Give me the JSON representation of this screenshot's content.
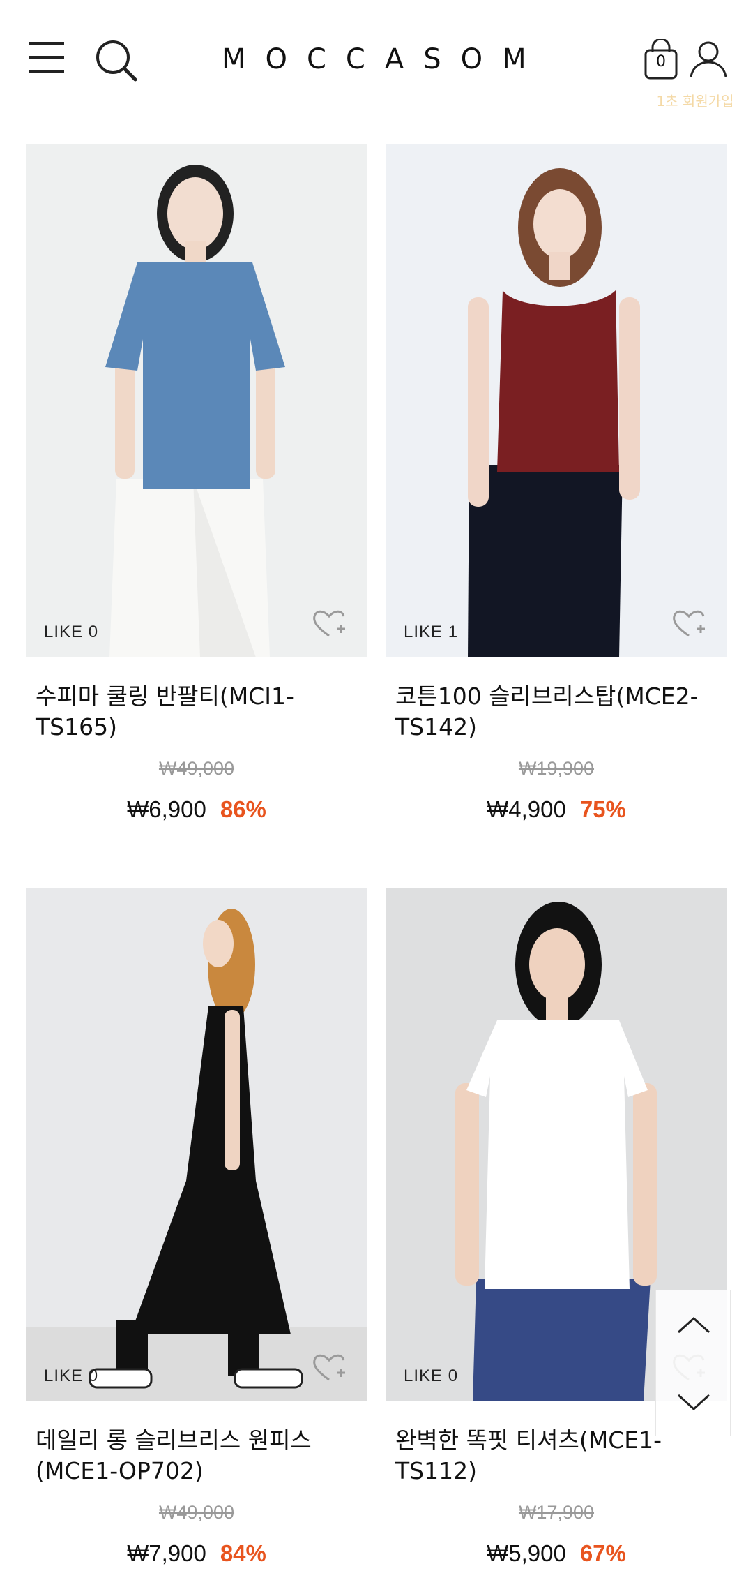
{
  "header": {
    "logo": "MOCCASOM",
    "cart_count": "0",
    "signup_badge": "1초 회원가입",
    "icons": [
      "menu-icon",
      "search-icon",
      "shopping-bag-icon",
      "user-icon"
    ]
  },
  "products": [
    {
      "like_label": "LIKE 0",
      "name": "수피마 쿨링 반팔티(MCI1-TS165)",
      "original_price": "₩49,000",
      "price": "₩6,900",
      "discount": "86%",
      "garment_color": "#5b88b8",
      "bg_color": "#eef0f0"
    },
    {
      "like_label": "LIKE 1",
      "name": "코튼100 슬리브리스탑(MCE2-TS142)",
      "original_price": "₩19,900",
      "price": "₩4,900",
      "discount": "75%",
      "garment_color": "#7a1f22",
      "bg_color": "#eef1f5"
    },
    {
      "like_label": "LIKE 0",
      "name": "데일리 롱 슬리브리스 원피스(MCE1-OP702)",
      "original_price": "₩49,000",
      "price": "₩7,900",
      "discount": "84%",
      "garment_color": "#111111",
      "bg_color": "#e8e9eb"
    },
    {
      "like_label": "LIKE 0",
      "name": "완벽한 똑핏 티셔츠(MCE1-TS112)",
      "original_price": "₩17,900",
      "price": "₩5,900",
      "discount": "67%",
      "garment_color": "#ffffff",
      "bg_color": "#dedfe0"
    }
  ],
  "colors": {
    "discount": "#e8541e",
    "strike_price": "#999999"
  }
}
